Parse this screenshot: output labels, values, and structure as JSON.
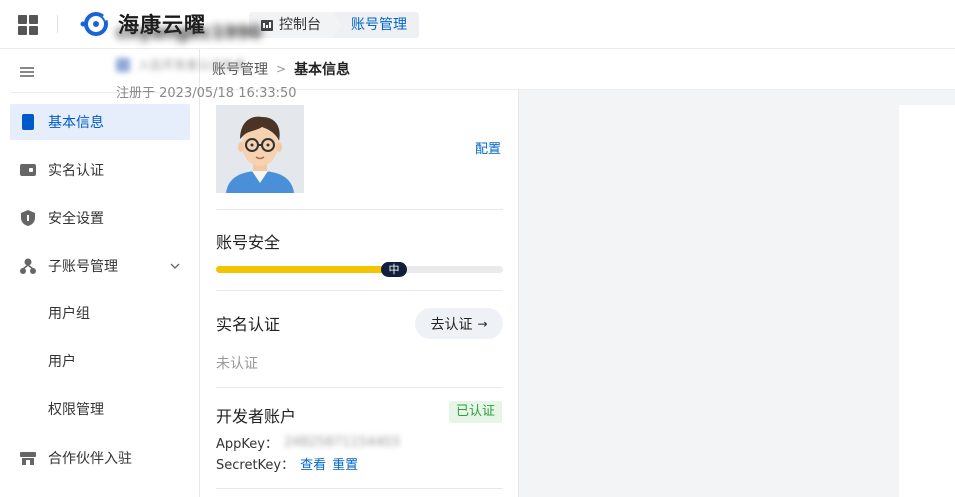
{
  "header": {
    "logo_text": "海康云曜",
    "breadcrumbs": [
      {
        "label": "控制台"
      },
      {
        "label": "账号管理"
      }
    ],
    "accent_color": "#0066cc"
  },
  "sidebar": {
    "items": [
      {
        "label": "基本信息",
        "icon": "document-icon",
        "active": true
      },
      {
        "label": "实名认证",
        "icon": "id-card-icon"
      },
      {
        "label": "安全设置",
        "icon": "shield-icon"
      },
      {
        "label": "子账号管理",
        "icon": "org-tree-icon",
        "expanded": true
      }
    ],
    "sub_items": [
      {
        "label": "用户组"
      },
      {
        "label": "用户"
      },
      {
        "label": "权限管理"
      }
    ],
    "bottom_item": {
      "label": "合作伙伴入驻",
      "icon": "storefront-icon"
    }
  },
  "path": {
    "parent": "账号管理",
    "current": "基本信息"
  },
  "profile": {
    "username": "cnyangkc1990",
    "subline": "入驻开发者认证信息",
    "registered": "注册于 2023/05/18 16:33:50"
  },
  "security": {
    "title": "账号安全",
    "config_label": "配置",
    "level_label": "中",
    "level_fraction": 0.62,
    "bar_color": "#f5c400"
  },
  "realname": {
    "title": "实名认证",
    "button_label": "去认证",
    "status": "未认证"
  },
  "developer": {
    "title": "开发者账户",
    "status_badge": "已认证",
    "appkey_label": "AppKey：",
    "appkey_value": "24825871154403",
    "secretkey_label": "SecretKey：",
    "view_label": "查看",
    "reset_label": "重置"
  }
}
